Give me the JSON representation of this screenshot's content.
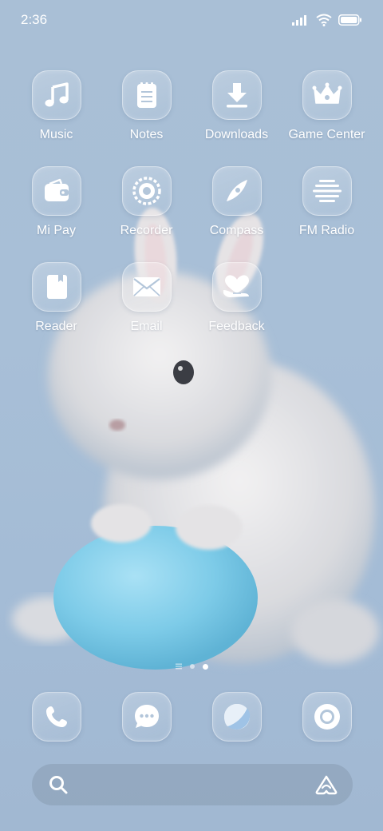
{
  "status_bar": {
    "time": "2:36"
  },
  "apps": [
    {
      "label": "Music",
      "icon": "music-icon"
    },
    {
      "label": "Notes",
      "icon": "notes-icon"
    },
    {
      "label": "Downloads",
      "icon": "download-icon"
    },
    {
      "label": "Game Center",
      "icon": "crown-icon"
    },
    {
      "label": "Mi Pay",
      "icon": "wallet-icon"
    },
    {
      "label": "Recorder",
      "icon": "recorder-icon"
    },
    {
      "label": "Compass",
      "icon": "compass-icon"
    },
    {
      "label": "FM Radio",
      "icon": "radio-icon"
    },
    {
      "label": "Reader",
      "icon": "book-icon"
    },
    {
      "label": "Email",
      "icon": "mail-icon"
    },
    {
      "label": "Feedback",
      "icon": "feedback-heart-icon"
    }
  ],
  "dock": [
    {
      "icon": "phone-icon"
    },
    {
      "icon": "messages-icon"
    },
    {
      "icon": "browser-icon"
    },
    {
      "icon": "camera-icon"
    }
  ],
  "page_indicator": {
    "pages": 3,
    "active": 3
  },
  "colors": {
    "background": "#a8bfd7",
    "accent": "#ffffff"
  }
}
